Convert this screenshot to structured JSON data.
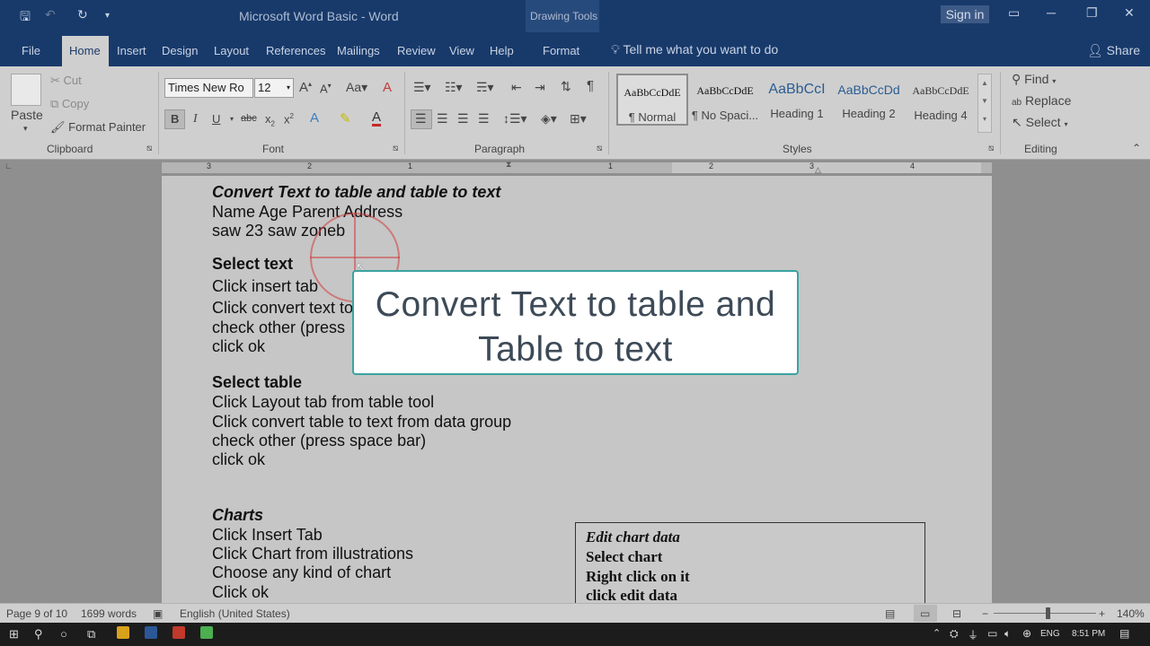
{
  "titlebar": {
    "title": "Microsoft Word Basic  -  Word",
    "contextual_label": "Drawing Tools",
    "sign_in": "Sign in"
  },
  "tabs": [
    {
      "label": "File"
    },
    {
      "label": "Home"
    },
    {
      "label": "Insert"
    },
    {
      "label": "Design"
    },
    {
      "label": "Layout"
    },
    {
      "label": "References"
    },
    {
      "label": "Mailings"
    },
    {
      "label": "Review"
    },
    {
      "label": "View"
    },
    {
      "label": "Help"
    },
    {
      "label": "Format"
    }
  ],
  "tell_me": "Tell me what you want to do",
  "share": "Share",
  "clipboard": {
    "group": "Clipboard",
    "paste": "Paste",
    "cut": "Cut",
    "copy": "Copy",
    "format_painter": "Format Painter"
  },
  "font": {
    "group": "Font",
    "family": "Times New Ro",
    "size": "12"
  },
  "paragraph": {
    "group": "Paragraph"
  },
  "styles": {
    "group": "Styles",
    "items": [
      {
        "preview": "AaBbCcDdE",
        "name": "¶ Normal"
      },
      {
        "preview": "AaBbCcDdE",
        "name": "¶ No Spaci..."
      },
      {
        "preview": "AaBbCcI",
        "name": "Heading 1"
      },
      {
        "preview": "AaBbCcDd",
        "name": "Heading 2"
      },
      {
        "preview": "AaBbCcDdE",
        "name": "Heading 4"
      }
    ]
  },
  "editing": {
    "group": "Editing",
    "find": "Find",
    "replace": "Replace",
    "select": "Select"
  },
  "ruler": {
    "numbers": [
      "3",
      "2",
      "1",
      "1",
      "2",
      "3",
      "4"
    ]
  },
  "document": {
    "lines": [
      {
        "text": "Convert Text to table and table to text",
        "style": "bi"
      },
      {
        "text": "Name Age Parent Address",
        "style": ""
      },
      {
        "text": "saw 23 saw zoneb",
        "style": ""
      },
      {
        "text": "Select text",
        "style": "b"
      },
      {
        "text": "Click insert tab",
        "style": ""
      },
      {
        "text": "Click convert text to",
        "style": ""
      },
      {
        "text": "check other (press",
        "style": ""
      },
      {
        "text": "click ok",
        "style": ""
      },
      {
        "text": "Select table",
        "style": "b"
      },
      {
        "text": "Click Layout tab from table tool",
        "style": ""
      },
      {
        "text": "Click convert table to text from data group",
        "style": ""
      },
      {
        "text": "check other (press space bar)",
        "style": ""
      },
      {
        "text": "click ok",
        "style": ""
      },
      {
        "text": "Charts",
        "style": "bi"
      },
      {
        "text": "Click Insert Tab",
        "style": ""
      },
      {
        "text": "Click Chart from illustrations",
        "style": ""
      },
      {
        "text": "Choose any kind of chart",
        "style": ""
      },
      {
        "text": "Click ok",
        "style": ""
      }
    ],
    "textbox": [
      "Edit chart data",
      "Select chart",
      "Right click on it",
      "click edit data"
    ]
  },
  "overlay": {
    "text": "Convert Text to table and Table to text"
  },
  "statusbar": {
    "page": "Page 9 of 10",
    "words": "1699 words",
    "language": "English (United States)",
    "zoom": "140%"
  },
  "taskbar": {
    "lang": "ENG",
    "time": "8:51 PM"
  }
}
